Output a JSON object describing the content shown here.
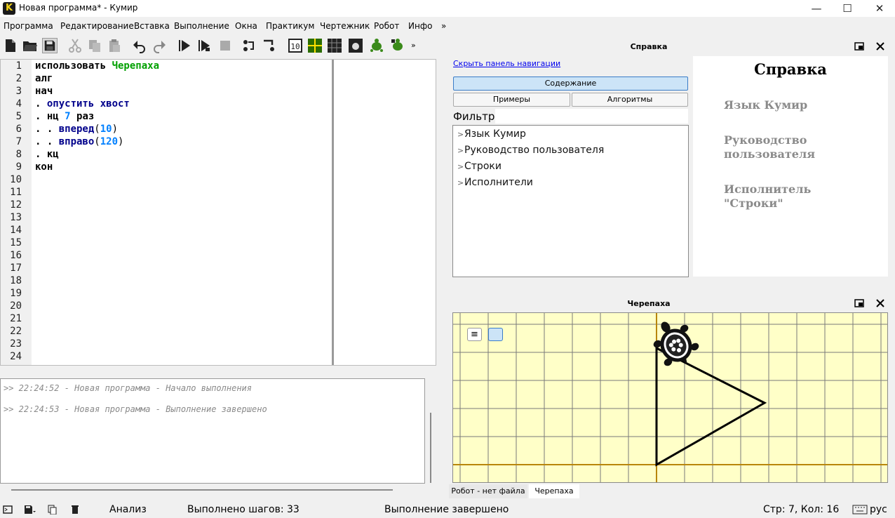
{
  "window": {
    "title": "Новая программа* - Кумир",
    "icon_letter": "K",
    "minimize": "—",
    "maximize": "☐",
    "close": "✕"
  },
  "menu": {
    "items": [
      "Программа",
      "Редактирование",
      "Вставка",
      "Выполнение",
      "Окна",
      "Практикум",
      "Чертежник",
      "Робот",
      "Инфо",
      "»"
    ]
  },
  "toolbar": {
    "overflow": "»"
  },
  "editor": {
    "line_numbers": [
      "1",
      "2",
      "3",
      "4",
      "5",
      "6",
      "7",
      "8",
      "9",
      "10",
      "11",
      "12",
      "13",
      "14",
      "15",
      "16",
      "17",
      "18",
      "19",
      "20",
      "21",
      "22",
      "23",
      "24"
    ],
    "lines": [
      {
        "parts": [
          {
            "t": "использовать ",
            "c": "kw"
          },
          {
            "t": "Черепаха",
            "c": "grn"
          }
        ]
      },
      {
        "parts": [
          {
            "t": "алг",
            "c": "kw"
          }
        ]
      },
      {
        "parts": [
          {
            "t": "нач",
            "c": "kw"
          }
        ]
      },
      {
        "parts": [
          {
            "t": ". ",
            "c": "kw"
          },
          {
            "t": "опустить хвост",
            "c": "kw2"
          }
        ]
      },
      {
        "parts": [
          {
            "t": ". нц ",
            "c": "kw"
          },
          {
            "t": "7",
            "c": "num"
          },
          {
            "t": " раз",
            "c": "kw"
          }
        ]
      },
      {
        "parts": [
          {
            "t": ". . ",
            "c": "kw"
          },
          {
            "t": "вперед",
            "c": "kw2"
          },
          {
            "t": "(",
            "c": "par"
          },
          {
            "t": "10",
            "c": "num"
          },
          {
            "t": ")",
            "c": "par"
          }
        ]
      },
      {
        "parts": [
          {
            "t": ". . ",
            "c": "kw"
          },
          {
            "t": "вправо",
            "c": "kw2"
          },
          {
            "t": "(",
            "c": "par"
          },
          {
            "t": "120",
            "c": "num"
          },
          {
            "t": ")",
            "c": "par"
          }
        ]
      },
      {
        "parts": [
          {
            "t": ". кц",
            "c": "kw"
          }
        ]
      },
      {
        "parts": [
          {
            "t": "кон",
            "c": "kw"
          }
        ]
      }
    ]
  },
  "console": {
    "lines": [
      ">> 22:24:52 - Новая программа - Начало выполнения",
      ">> 22:24:53 - Новая программа - Выполнение завершено"
    ]
  },
  "help": {
    "panel_title": "Справка",
    "hide_nav": "Скрыть панель навигации",
    "btn_contents": "Содержание",
    "btn_examples": "Примеры",
    "btn_algorithms": "Алгоритмы",
    "filter_label": "Фильтр:",
    "tree": [
      "Язык Кумир",
      "Руководство пользователя",
      "Строки",
      "Исполнители"
    ],
    "page_title": "Справка",
    "page_links": [
      "Язык Кумир",
      "Руководство\nпользователя",
      "Исполнитель\n\"Строки\""
    ]
  },
  "turtle": {
    "panel_title": "Черепаха",
    "grid_color": "#7a7a7a",
    "axis_color": "#b8860b",
    "bg_color": "#ffffc8"
  },
  "tabs": {
    "robot": "Робот - нет файла",
    "turtle": "Черепаха"
  },
  "status": {
    "mode": "Анализ",
    "steps": "Выполнено шагов: 33",
    "message": "Выполнение завершено",
    "cursor": "Стр: 7, Кол: 16",
    "lang": "рус"
  }
}
